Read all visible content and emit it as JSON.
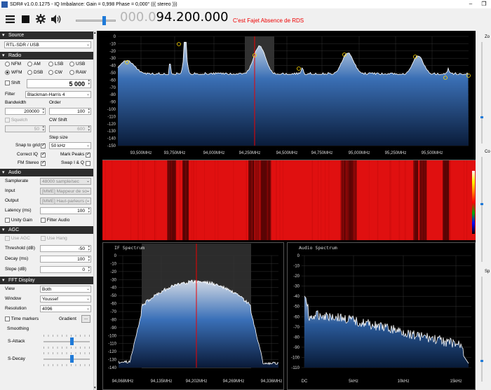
{
  "window": {
    "title": "SDR# v1.0.0.1275 - IQ Imbalance: Gain = 0,998 Phase = 0,000° ((( stereo )))",
    "app_icon": "sdr-app-icon"
  },
  "toolbar": {
    "freq_dim": "000.0",
    "freq_lit": "94.200.000",
    "rds": "C'est Fajet Absence de RDS",
    "icons": [
      "menu-icon",
      "stop-icon",
      "gear-icon",
      "speaker-icon"
    ]
  },
  "source": {
    "header": "Source",
    "device": "RTL-SDR / USB"
  },
  "radio": {
    "header": "Radio",
    "modes_row1": [
      "NFM",
      "AM",
      "LSB",
      "USB"
    ],
    "modes_row2": [
      "WFM",
      "DSB",
      "CW",
      "RAW"
    ],
    "selected_mode": "WFM",
    "shift_label": "Shift",
    "shift_value": "5 000",
    "filter_label": "Filter",
    "filter_value": "Blackman-Harris 4",
    "bandwidth_label": "Bandwidth",
    "order_label": "Order",
    "bandwidth_value": "200000",
    "order_value": "100",
    "squelch_label": "Squelch",
    "cw_shift_label": "CW Shift",
    "squelch_value": "50",
    "cw_shift_value": "600",
    "step_size_label": "Step size",
    "snap_label": "Snap to grid",
    "step_value": "50 kHz",
    "correct_iq_label": "Correct IQ",
    "mark_peaks_label": "Mark Peaks",
    "fm_stereo_label": "FM Stereo",
    "swap_iq_label": "Swap I & Q"
  },
  "audio": {
    "header": "Audio",
    "samplerate_label": "Samplerate",
    "samplerate_value": "48000 sample/sec",
    "input_label": "Input",
    "input_value": "[MME] Mappeur de so",
    "output_label": "Output",
    "output_value": "[MME] Haut-parleurs (",
    "latency_label": "Latency (ms)",
    "latency_value": "100",
    "unity_gain_label": "Unity Gain",
    "filter_audio_label": "Filter Audio"
  },
  "agc": {
    "header": "AGC",
    "use_agc_label": "Use AGC",
    "use_hang_label": "Use Hang",
    "threshold_label": "Threshold (dB)",
    "threshold_value": "-50",
    "decay_label": "Decay (ms)",
    "decay_value": "100",
    "slope_label": "Slope (dB)",
    "slope_value": "0"
  },
  "fft": {
    "header": "FFT Display",
    "view_label": "View",
    "view_value": "Both",
    "window_label": "Window",
    "window_value": "Youssef",
    "resolution_label": "Resolution",
    "resolution_value": "4096",
    "time_markers_label": "Time markers",
    "gradient_label": "Gradient",
    "gradient_btn": "...",
    "smoothing_label": "Smoothing",
    "s_attack_label": "S-Attack",
    "s_decay_label": "S-Decay",
    "s_attack_level": 0.6,
    "s_decay_level": 0.6
  },
  "right_panel": {
    "zoom_label": "Zo",
    "contrast_label": "Co",
    "speed_label": "Sp"
  },
  "spectrum": {
    "y_ticks": [
      "0",
      "-10",
      "-20",
      "-30",
      "-40",
      "-50",
      "-60",
      "-70",
      "-80",
      "-90",
      "-100",
      "-110",
      "-120",
      "-130",
      "-140",
      "-150"
    ],
    "x_ticks": [
      "93,500MHz",
      "93,750MHz",
      "94,000MHz",
      "94,250MHz",
      "94,500MHz",
      "94,750MHz",
      "95,000MHz",
      "95,250MHz",
      "95,500MHz"
    ]
  },
  "if_spectrum": {
    "title": "IF Spectrum",
    "y_ticks": [
      "0",
      "-10",
      "-20",
      "-30",
      "-40",
      "-50",
      "-60",
      "-70",
      "-80",
      "-90",
      "-100",
      "-110",
      "-120",
      "-130",
      "-140"
    ],
    "x_ticks": [
      "94,068MHz",
      "94,135MHz",
      "94,202MHz",
      "94,269MHz",
      "94,336MHz"
    ]
  },
  "audio_spectrum": {
    "title": "Audio Spectrum",
    "y_ticks": [
      "0",
      "-10",
      "-20",
      "-30",
      "-40",
      "-50",
      "-60",
      "-70",
      "-80",
      "-90",
      "-100",
      "-110"
    ],
    "x_ticks": [
      "DC",
      "5kHz",
      "10kHz",
      "15kHz"
    ]
  }
}
